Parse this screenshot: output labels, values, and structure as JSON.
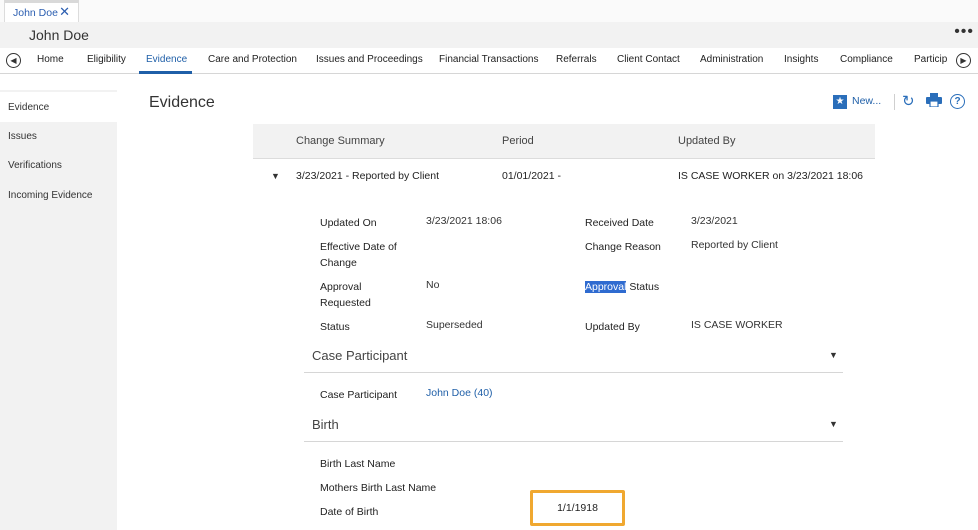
{
  "tabstrip": {
    "tab_label": "John Doe",
    "close_icon": "close-icon"
  },
  "header": {
    "person_name": "John Doe",
    "more": "•••"
  },
  "nav": {
    "tabs": [
      "Home",
      "Eligibility",
      "Evidence",
      "Care and Protection",
      "Issues and Proceedings",
      "Financial Transactions",
      "Referrals",
      "Client Contact",
      "Administration",
      "Insights",
      "Compliance",
      "Particip"
    ],
    "active": "Evidence"
  },
  "sidebar": {
    "items": [
      "Evidence",
      "Issues",
      "Verifications",
      "Incoming Evidence"
    ]
  },
  "main": {
    "title": "Evidence",
    "new_label": "New...",
    "table": {
      "headers": [
        "Change Summary",
        "Period",
        "Updated By"
      ],
      "row": {
        "summary": "3/23/2021 - Reported by Client",
        "period": "01/01/2021 -",
        "updated_by": "IS CASE WORKER on 3/23/2021 18:06"
      }
    },
    "details": {
      "updated_on_label": "Updated On",
      "updated_on_value": "3/23/2021 18:06",
      "received_date_label": "Received Date",
      "received_date_value": "3/23/2021",
      "effective_label_1": "Effective Date of",
      "effective_label_2": "Change",
      "change_reason_label": "Change Reason",
      "change_reason_value": "Reported by Client",
      "approval_req_label_1": "Approval",
      "approval_req_label_2": "Requested",
      "approval_req_value": "No",
      "approval_status_hl": "Approval",
      "approval_status_rest": " Status",
      "status_label": "Status",
      "status_value": "Superseded",
      "updated_by_label": "Updated By",
      "updated_by_value": "IS CASE WORKER"
    },
    "case_participant": {
      "title": "Case Participant",
      "label": "Case Participant",
      "value": "John Doe (40)"
    },
    "birth": {
      "title": "Birth",
      "last_name_label": "Birth Last Name",
      "mothers_label": "Mothers Birth Last Name",
      "dob_label": "Date of Birth",
      "dob_value": "1/1/1918"
    }
  },
  "colors": {
    "accent": "#1f5fa8",
    "highlight_box": "#f0a830",
    "selection": "#2f6bd0"
  }
}
